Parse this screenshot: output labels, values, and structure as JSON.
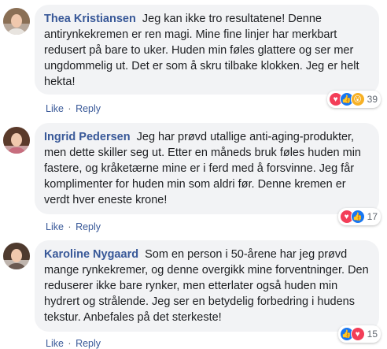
{
  "comments": [
    {
      "author": "Thea Kristiansen",
      "text": "Jeg kan ikke tro resultatene! Denne antirynkekremen er ren magi. Mine fine linjer har merkbart redusert på bare to uker. Huden min føles glattere og ser mer ungdommelig ut. Det er som å skru tilbake klokken. Jeg er helt hekta!",
      "like": "Like",
      "reply": "Reply",
      "reaction_count": "39",
      "reactions": [
        "love-icon",
        "like-icon",
        "wow-icon"
      ]
    },
    {
      "author": "Ingrid Pedersen",
      "text": "Jeg har prøvd utallige anti-aging-produkter, men dette skiller seg ut. Etter en måneds bruk føles huden min fastere, og kråketærne mine er i ferd med å forsvinne. Jeg får komplimenter for huden min som aldri før. Denne kremen er verdt hver eneste krone!",
      "like": "Like",
      "reply": "Reply",
      "reaction_count": "17",
      "reactions": [
        "love-icon",
        "like-icon"
      ]
    },
    {
      "author": "Karoline Nygaard",
      "text": "Som en person i 50-årene har jeg prøvd mange rynkekremer, og denne overgikk mine forventninger. Den reduserer ikke bare rynker, men etterlater også huden min hydrert og strålende. Jeg ser en betydelig forbedring i hudens tekstur. Anbefales på det sterkeste!",
      "like": "Like",
      "reply": "Reply",
      "reaction_count": "15",
      "reactions": [
        "like-icon",
        "love-icon"
      ]
    }
  ],
  "colors": {
    "author": "#385898",
    "bubble": "#f2f3f5",
    "like_blue": "#1877f2",
    "love_red": "#f33e58",
    "wow_yellow": "#f7b125"
  }
}
